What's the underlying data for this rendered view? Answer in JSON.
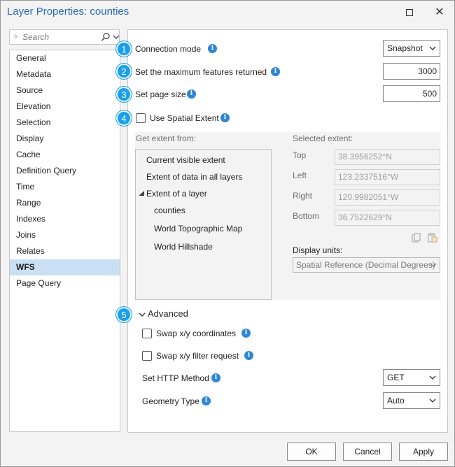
{
  "window": {
    "title": "Layer Properties: counties"
  },
  "search": {
    "placeholder": "Search"
  },
  "sidebar": {
    "items": [
      {
        "label": "General"
      },
      {
        "label": "Metadata"
      },
      {
        "label": "Source"
      },
      {
        "label": "Elevation"
      },
      {
        "label": "Selection"
      },
      {
        "label": "Display"
      },
      {
        "label": "Cache"
      },
      {
        "label": "Definition Query"
      },
      {
        "label": "Time"
      },
      {
        "label": "Range"
      },
      {
        "label": "Indexes"
      },
      {
        "label": "Joins"
      },
      {
        "label": "Relates"
      },
      {
        "label": "WFS",
        "selected": true
      },
      {
        "label": "Page Query"
      }
    ]
  },
  "callouts": [
    "1",
    "2",
    "3",
    "4",
    "5"
  ],
  "settings": {
    "connection_mode": {
      "label": "Connection mode",
      "value": "Snapshot"
    },
    "max_features": {
      "label": "Set the maximum features returned",
      "value": "3000"
    },
    "page_size": {
      "label": "Set page size",
      "value": "500"
    },
    "use_spatial_extent": {
      "label": "Use Spatial Extent",
      "checked": false
    }
  },
  "extent": {
    "get_from_label": "Get extent from:",
    "sources": {
      "current_visible": "Current visible extent",
      "data_all_layers": "Extent of data in all layers",
      "of_a_layer": "Extent of a layer",
      "layers": [
        "counties",
        "World Topographic Map",
        "World Hillshade"
      ]
    },
    "selected_label": "Selected extent:",
    "top": {
      "label": "Top",
      "value": "38.3956252°N"
    },
    "left": {
      "label": "Left",
      "value": "123.2337516°W"
    },
    "right": {
      "label": "Right",
      "value": "120.9982051°W"
    },
    "bottom": {
      "label": "Bottom",
      "value": "36.7522629°N"
    },
    "display_units_label": "Display units:",
    "display_units_value": "Spatial Reference (Decimal Degrees)"
  },
  "advanced": {
    "header": "Advanced",
    "swap_xy": {
      "label": "Swap x/y coordinates",
      "checked": false
    },
    "swap_filter": {
      "label": "Swap x/y filter request",
      "checked": false
    },
    "http_method": {
      "label": "Set HTTP Method",
      "value": "GET"
    },
    "geometry_type": {
      "label": "Geometry Type",
      "value": "Auto"
    }
  },
  "footer": {
    "ok": "OK",
    "cancel": "Cancel",
    "apply": "Apply"
  },
  "colors": {
    "accent": "#1aa0e8",
    "info": "#2f86d6",
    "title": "#2a6bb5",
    "selection": "#c9dff3"
  }
}
